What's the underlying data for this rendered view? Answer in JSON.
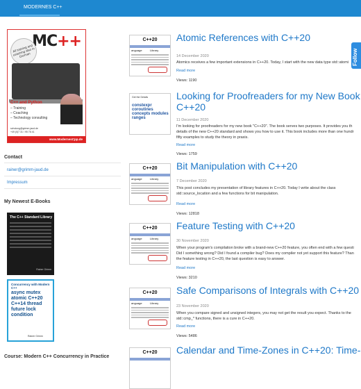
{
  "nav": {
    "item": "MODERNES C++"
  },
  "book": {
    "logo_mc": "MC",
    "logo_pp": "++",
    "badge": "All training and coaching also in German",
    "title": "C++ and Python",
    "bullets": [
      "Training",
      "Coaching",
      "Technology consulting"
    ],
    "contact": [
      "schulung@grimm-jaud.de",
      "+49 (0)7 31 / 95 76 41"
    ],
    "url": "www.ModernesCpp.de"
  },
  "contact": {
    "heading": "Contact",
    "email": "rainer@grimm-jaud.de",
    "impressum": "Impressum"
  },
  "ebooks": {
    "heading": "My Newest E-Books",
    "book1": {
      "title": "The C++ Standard Library",
      "author": "Rainer Grimm"
    },
    "book2": {
      "title": "Concurrency with Modern C++",
      "cloud": "async mutex atomic C++20 C++14 thread future lock condition",
      "author": "Rainer Grimm"
    }
  },
  "course": {
    "heading": "Course: Modern C++ Concurrency in Practice"
  },
  "follow": "Follow",
  "thumb": {
    "title": "C++20",
    "col1": "anguage",
    "col2": "Library",
    "cloud_header": "Get the Details",
    "cloud": "constexpr coroutines concepts modules ranges"
  },
  "posts": [
    {
      "title": "Atomic References with C++20",
      "date": "14 December 2020",
      "excerpt": "Atomics receives a few important extensions in C++20. Today, I start with the new data type std::atomi",
      "readmore": "Read more",
      "views": "Views: 1190"
    },
    {
      "title": "Looking for Proofreaders for my New Book:",
      "title2": "C++20",
      "date": "11 December 2020",
      "excerpt": "I'm looking for proofreaders for my new book \"C++20\". The book serves two purposes. It provides you th\ndetails of the new C++20 standard and shows you how to use it. This book includes more than one hundr\nfifty examples to study the theory in praxis.",
      "readmore": "Read more",
      "views": "Views: 1759"
    },
    {
      "title": "Bit Manipulation with C++20",
      "date": "7 December 2020",
      "excerpt": "This post concludes my presentation of library features in C++20. Today I write about the class\nstd::source_location and a few functions for bit manipulation.",
      "readmore": "Read more",
      "views": "Views: 12818"
    },
    {
      "title": "Feature Testing with C++20",
      "date": "30 November 2020",
      "excerpt": "When your program's compilation broke with a brand-new C++20 feature, you often end with a few questi\nDid I something wrong? Did I found a compiler bug? Does my compiler not yet support this feature? Than\nthe feature testing in C++20, the last question is easy to answer.",
      "readmore": "Read more",
      "views": "Views: 3210"
    },
    {
      "title": "Safe Comparisons of Integrals with C++20",
      "date": "23 November 2020",
      "excerpt": "When you compare signed and unsigned integers, you may not get the result you expect. Thanks to the\nstd::cmp_* functions, there is a cure in C++20.",
      "readmore": "Read more",
      "views": "Views: 5486"
    },
    {
      "title": "Calendar and Time-Zones in C++20: Time-"
    }
  ]
}
